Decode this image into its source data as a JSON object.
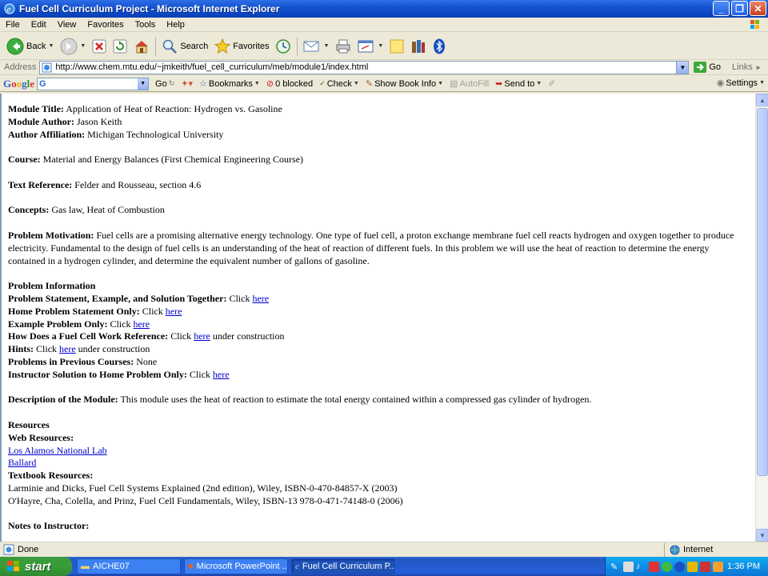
{
  "window": {
    "title": "Fuel Cell Curriculum Project - Microsoft Internet Explorer"
  },
  "menu": [
    "File",
    "Edit",
    "View",
    "Favorites",
    "Tools",
    "Help"
  ],
  "toolbar": {
    "back": "Back",
    "search": "Search",
    "favorites": "Favorites"
  },
  "address": {
    "label": "Address",
    "url": "http://www.chem.mtu.edu/~jmkeith/fuel_cell_curriculum/meb/module1/index.html",
    "go": "Go",
    "links": "Links"
  },
  "google_toolbar": {
    "logo": "Google",
    "search_prefix": "G",
    "go": "Go",
    "bookmarks": "Bookmarks",
    "blocked": "0 blocked",
    "check": "Check",
    "show_book_info": "Show Book Info",
    "autofill": "AutoFill",
    "send_to": "Send to",
    "settings": "Settings"
  },
  "content": {
    "module_title_label": "Module Title:",
    "module_title": "Application of Heat of Reaction: Hydrogen vs. Gasoline",
    "module_author_label": "Module Author:",
    "module_author": "Jason Keith",
    "author_affiliation_label": "Author Affiliation:",
    "author_affiliation": "Michigan Technological University",
    "course_label": "Course:",
    "course": "Material and Energy Balances (First Chemical Engineering Course)",
    "text_reference_label": "Text Reference:",
    "text_reference": "Felder and Rousseau, section 4.6",
    "concepts_label": "Concepts:",
    "concepts": "Gas law, Heat of Combustion",
    "problem_motivation_label": "Problem Motivation:",
    "problem_motivation": "Fuel cells are a promising alternative energy technology. One type of fuel cell, a proton exchange membrane fuel cell reacts hydrogen and oxygen together to produce electricity. Fundamental to the design of fuel cells is an understanding of the heat of reaction of different fuels. In this problem we will use the heat of reaction to determine the energy contained in a hydrogen cylinder, and determine the equivalent number of gallons of gasoline.",
    "problem_information_heading": "Problem Information",
    "click": "Click",
    "here": "here",
    "under_construction": "under construction",
    "items": {
      "pse_together": "Problem Statement, Example, and Solution Together:",
      "home_problem_only": "Home Problem Statement Only:",
      "example_only": "Example Problem Only:",
      "how_fuel_cell": "How Does a Fuel Cell Work Reference:",
      "hints": "Hints:",
      "previous_courses": "Problems in Previous Courses:",
      "previous_courses_value": "None",
      "instructor_solution": "Instructor Solution to Home Problem Only:"
    },
    "description_label": "Description of the Module:",
    "description": "This module uses the heat of reaction to estimate the total energy contained within a compressed gas cylinder of hydrogen.",
    "resources_heading": "Resources",
    "web_resources_label": "Web Resources:",
    "web_links": [
      "Los Alamos National Lab",
      "Ballard"
    ],
    "textbook_resources_label": "Textbook Resources:",
    "textbooks": [
      "Larminie and Dicks, Fuel Cell Systems Explained (2nd edition), Wiley, ISBN-0-470-84857-X (2003)",
      "O'Hayre, Cha, Colella, and Prinz, Fuel Cell Fundamentals, Wiley, ISBN-13 978-0-471-74148-0 (2006)"
    ],
    "notes_label": "Notes to Instructor:"
  },
  "status": {
    "text": "Done",
    "zone": "Internet"
  },
  "taskbar": {
    "start": "start",
    "tasks": [
      "AICHE07",
      "Microsoft PowerPoint ...",
      "Fuel Cell Curriculum P..."
    ],
    "clock": "1:36 PM"
  },
  "colors": {
    "link": "#0000cc",
    "titlebar": "#0a46c4",
    "start": "#389c38"
  }
}
